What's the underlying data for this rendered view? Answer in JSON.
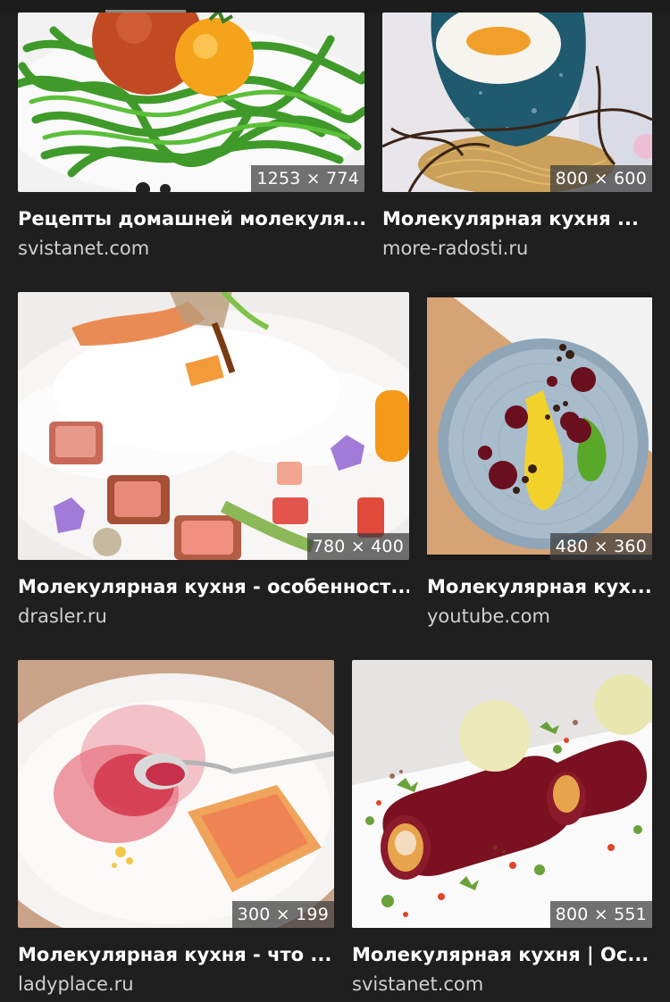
{
  "results": [
    {
      "title": "Рецепты домашней молекуля...",
      "source": "svistanet.com",
      "dims": "1253 × 774"
    },
    {
      "title": "Молекулярная кухня ...",
      "source": "more-radosti.ru",
      "dims": "800 × 600"
    },
    {
      "title": "Молекулярная кухня - особенност...",
      "source": "drasler.ru",
      "dims": "780 × 400"
    },
    {
      "title": "Молекулярная кух...",
      "source": "youtube.com",
      "dims": "480 × 360"
    },
    {
      "title": "Молекулярная кухня - что ...",
      "source": "ladyplace.ru",
      "dims": "300 × 199"
    },
    {
      "title": "Молекулярная кухня | Ос...",
      "source": "svistanet.com",
      "dims": "800 × 551"
    }
  ],
  "colors": {
    "background": "#1f1f1f",
    "title": "#ffffff",
    "source": "#cfcfcf"
  }
}
